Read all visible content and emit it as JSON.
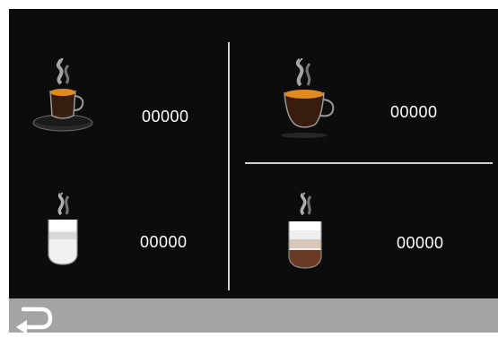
{
  "counters": {
    "espresso": "00000",
    "coffee": "00000",
    "latte_macchiato": "00000",
    "cappuccino": "00000"
  },
  "icons": {
    "espresso": "espresso-cup-icon",
    "coffee": "coffee-cup-icon",
    "latte_macchiato": "latte-macchiato-glass-icon",
    "cappuccino": "cappuccino-glass-icon",
    "back": "back-arrow-icon"
  },
  "colors": {
    "background": "#0c0c0c",
    "divider": "#cfcfcf",
    "footer": "#a4a4a4",
    "text": "#ffffff"
  }
}
